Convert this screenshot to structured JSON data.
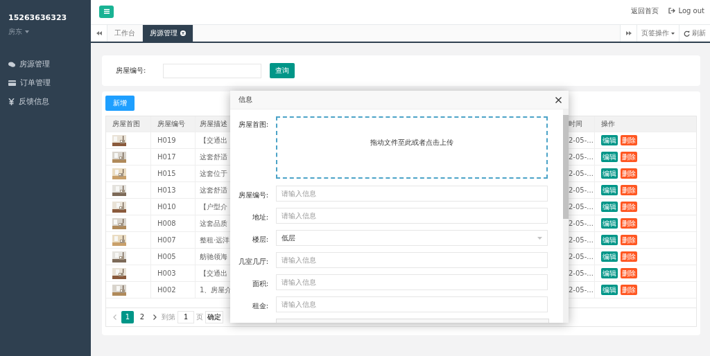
{
  "sidebar": {
    "user": {
      "phone": "15263636323",
      "role": "房东"
    },
    "items": [
      {
        "kind": "comments",
        "label": "房源管理"
      },
      {
        "kind": "card",
        "label": "订单管理"
      },
      {
        "kind": "yen",
        "label": "反馈信息"
      }
    ]
  },
  "header": {
    "links": [
      {
        "kind": "home",
        "label": "返回首页"
      },
      {
        "kind": "logout",
        "label": "Log out"
      }
    ]
  },
  "tabs": [
    {
      "label": "工作台",
      "selected": false,
      "closable": false
    },
    {
      "label": "房源管理",
      "selected": true,
      "closable": true
    }
  ],
  "tab_tools": [
    {
      "kind": "menu",
      "label": "页签操作"
    },
    {
      "kind": "refresh",
      "label": "刷新"
    }
  ],
  "search": {
    "label": "房屋编号:",
    "button": "查询"
  },
  "table": {
    "add_button": "新增",
    "columns": [
      "房屋首图",
      "房屋编号",
      "房屋描述",
      "时间",
      "操作"
    ],
    "rows": [
      {
        "number": "H019",
        "description": "【交通出",
        "time": "2-05-...",
        "actions": [
          "编辑",
          "删除"
        ]
      },
      {
        "number": "H017",
        "description": "这套舒适",
        "time": "2-05-...",
        "actions": [
          "编辑",
          "删除"
        ]
      },
      {
        "number": "H015",
        "description": "这套位于",
        "time": "2-05-...",
        "actions": [
          "编辑",
          "删除"
        ]
      },
      {
        "number": "H013",
        "description": "这套舒适",
        "time": "2-05-...",
        "actions": [
          "编辑",
          "删除"
        ]
      },
      {
        "number": "H010",
        "description": "【户型介",
        "time": "2-05-...",
        "actions": [
          "编辑",
          "删除"
        ]
      },
      {
        "number": "H008",
        "description": "这套品质",
        "time": "2-05-...",
        "actions": [
          "编辑",
          "删除"
        ]
      },
      {
        "number": "H007",
        "description": "整租·远洋",
        "time": "2-05-...",
        "actions": [
          "编辑",
          "删除"
        ]
      },
      {
        "number": "H005",
        "description": "舫驰领海",
        "time": "2-05-...",
        "actions": [
          "编辑",
          "删除"
        ]
      },
      {
        "number": "H003",
        "description": "【交通出",
        "time": "2-05-...",
        "actions": [
          "编辑",
          "删除"
        ]
      },
      {
        "number": "H002",
        "description": "1、房屋介",
        "time": "2-05-...",
        "actions": [
          "编辑",
          "删除"
        ]
      }
    ],
    "pagination": {
      "pages": [
        {
          "label": "1",
          "selected": true
        },
        {
          "label": "2",
          "selected": false
        }
      ],
      "goto_label": "到第",
      "goto_value": "1",
      "unit": "页",
      "confirm": "确定"
    }
  },
  "modal": {
    "title": "信息",
    "upload": {
      "label": "房屋首图:",
      "hint": "拖动文件至此或者点击上传"
    },
    "fields": [
      {
        "kind": "input",
        "label": "房屋编号:",
        "placeholder": "请输入信息"
      },
      {
        "kind": "input",
        "label": "地址:",
        "placeholder": "请输入信息"
      },
      {
        "kind": "select",
        "label": "楼层:",
        "value": "低层"
      },
      {
        "kind": "input",
        "label": "几室几厅:",
        "placeholder": "请输入信息"
      },
      {
        "kind": "input",
        "label": "面积:",
        "placeholder": "请输入信息"
      },
      {
        "kind": "input",
        "label": "租金:",
        "placeholder": "请输入信息"
      }
    ]
  }
}
